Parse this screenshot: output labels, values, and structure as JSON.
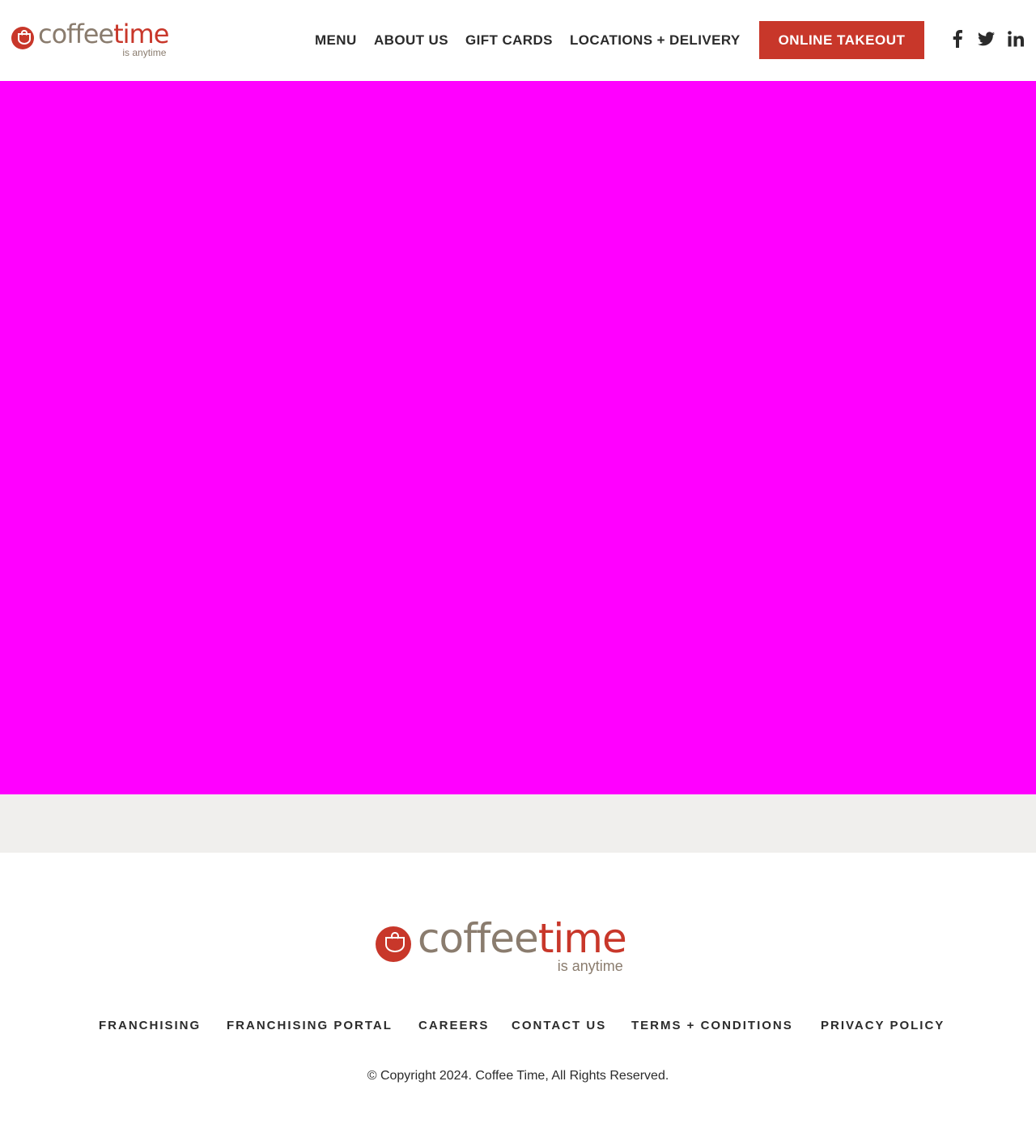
{
  "brand": {
    "name_part1": "coffee",
    "name_part2": "time",
    "tagline": "is anytime",
    "primary_color": "#c8372a",
    "secondary_color": "#8a7c6e"
  },
  "nav": {
    "items": [
      {
        "label": "MENU"
      },
      {
        "label": "ABOUT US"
      },
      {
        "label": "GIFT CARDS"
      },
      {
        "label": "LOCATIONS + DELIVERY"
      }
    ],
    "cta_label": "ONLINE TAKEOUT"
  },
  "social": {
    "icons": [
      "facebook-icon",
      "twitter-icon",
      "linkedin-icon"
    ]
  },
  "hero": {
    "background_color": "#ff00ff"
  },
  "band": {
    "background_color": "#f0efed"
  },
  "footer": {
    "links": [
      {
        "label": "FRANCHISING"
      },
      {
        "label": "FRANCHISING PORTAL"
      },
      {
        "label": "CAREERS"
      },
      {
        "label": "CONTACT US"
      },
      {
        "label": "TERMS + CONDITIONS"
      },
      {
        "label": "PRIVACY POLICY"
      }
    ],
    "copyright": "© Copyright 2024. Coffee Time, All Rights Reserved."
  }
}
